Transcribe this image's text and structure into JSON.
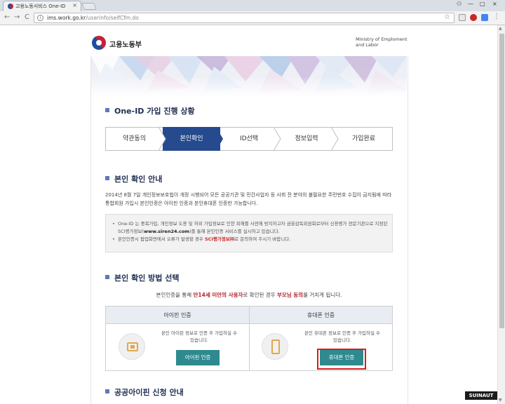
{
  "browser": {
    "tab_title": "고용노동서비스 One-ID",
    "tab_close": "×",
    "url_host": "ims.work.go.kr",
    "url_path": "/userinfo/selfCfm.do",
    "nav_back": "←",
    "nav_forward": "→",
    "nav_reload": "C",
    "star": "☆",
    "win_min": "—",
    "win_max": "□",
    "win_close": "×"
  },
  "header": {
    "logo_text": "고용노동부",
    "ministry_en": "Ministry of Emploment and Labor"
  },
  "progress": {
    "title": "One-ID 가입 진행 상황",
    "steps": [
      "약관동의",
      "본인확인",
      "ID선택",
      "정보입력",
      "가입완료"
    ],
    "active_step": 1
  },
  "identity": {
    "title": "본인 확인 안내",
    "paragraph": "2014년 8월 7일 개인정보보호법이 개정 시행되어 모든 공공기관 및 민간사업자 등 사회 전 분야의 불필요한 주민번호 수집이 금지됨에 따라 통합회원 가입시 본인인증은 아이핀 인증과 본인휴대폰 인증만 가능합니다.",
    "notice_1a": "One-ID 는 중복가입, 개인정보 도용 및 허위 가입정보로 인한 피해를 사전에 방지하고자 금융감독위원회로부터 신용평가 전문기관으로 지정된 SCI평가정보(",
    "notice_1b": "www.siren24.com",
    "notice_1c": ")를 통해 본인인증 서비스를 실시하고 있습니다.",
    "notice_2a": "본인인증시 팝업화면에서 오류가 발생할 경우 ",
    "notice_2b": "SCI평가정보㈜",
    "notice_2c": "로 문의하여 주시기 바랍니다."
  },
  "method": {
    "title": "본인 확인 방법 선택",
    "sub_a": "본인인증을 통해 ",
    "sub_b": "만14세 미만의 사용자",
    "sub_c": "로 확인된 경우 ",
    "sub_d": "부모님 동의",
    "sub_e": "를 거치게 됩니다.",
    "ipin": {
      "title": "아이핀 인증",
      "desc": "본인 아이핀 정보로 인증 후 가입하실 수 있습니다.",
      "button": "아이핀 인증"
    },
    "phone": {
      "title": "휴대폰 인증",
      "desc": "본인 휴대폰 정보로 인증 후 가입하실 수 있습니다.",
      "button": "휴대폰 인증"
    }
  },
  "public_ipin": {
    "title": "공공아이핀 신청 안내"
  },
  "watermark": "SUINAUT"
}
